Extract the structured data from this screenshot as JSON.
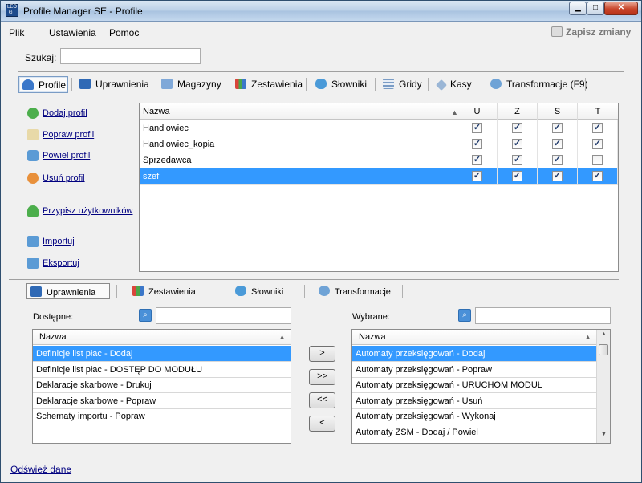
{
  "window": {
    "title": "Profile Manager SE - Profile",
    "icon_text": "LEO\nGT"
  },
  "menu": {
    "items": [
      "Plik",
      "Ustawienia",
      "Pomoc"
    ],
    "save_label": "Zapisz zmiany"
  },
  "search": {
    "label": "Szukaj:",
    "value": ""
  },
  "tabs": [
    "Profile",
    "Uprawnienia",
    "Magazyny",
    "Zestawienia",
    "Słowniki",
    "Gridy",
    "Kasy",
    "Transformacje (F9)"
  ],
  "active_tab": "Profile",
  "actions": [
    "Dodaj profil",
    "Popraw profil",
    "Powiel profil",
    "Usuń profil",
    "Przypisz użytkowników",
    "Importuj",
    "Eksportuj"
  ],
  "grid": {
    "columns": [
      "Nazwa",
      "U",
      "Z",
      "S",
      "T"
    ],
    "rows": [
      {
        "name": "Handlowiec",
        "checks": [
          true,
          true,
          true,
          true
        ],
        "selected": false
      },
      {
        "name": "Handlowiec_kopia",
        "checks": [
          true,
          true,
          true,
          true
        ],
        "selected": false
      },
      {
        "name": "Sprzedawca",
        "checks": [
          true,
          true,
          true,
          false
        ],
        "selected": false
      },
      {
        "name": "szef",
        "checks": [
          true,
          true,
          true,
          true
        ],
        "selected": true
      }
    ]
  },
  "subtabs": [
    "Uprawnienia",
    "Zestawienia",
    "Słowniki",
    "Transformacje"
  ],
  "available": {
    "label": "Dostępne:",
    "header": "Nazwa",
    "items": [
      "Definicje list płac - Dodaj",
      "Definicje list płac - DOSTĘP DO MODUŁU",
      "Deklaracje skarbowe - Drukuj",
      "Deklaracje skarbowe - Popraw",
      "Schematy importu - Popraw"
    ],
    "selected_index": 0
  },
  "selected": {
    "label": "Wybrane:",
    "header": "Nazwa",
    "items": [
      "Automaty przeksięgowań - Dodaj",
      "Automaty przeksięgowań - Popraw",
      "Automaty przeksięgowań - URUCHOM MODUŁ",
      "Automaty przeksięgowań - Usuń",
      "Automaty przeksięgowań - Wykonaj",
      "Automaty ZSM - Dodaj / Powiel"
    ],
    "selected_index": 0
  },
  "move_buttons": [
    ">",
    ">>",
    "<<",
    "<"
  ],
  "status": {
    "refresh_label": "Odśwież dane"
  },
  "colors": {
    "selection": "#3399ff",
    "link": "#000080"
  }
}
